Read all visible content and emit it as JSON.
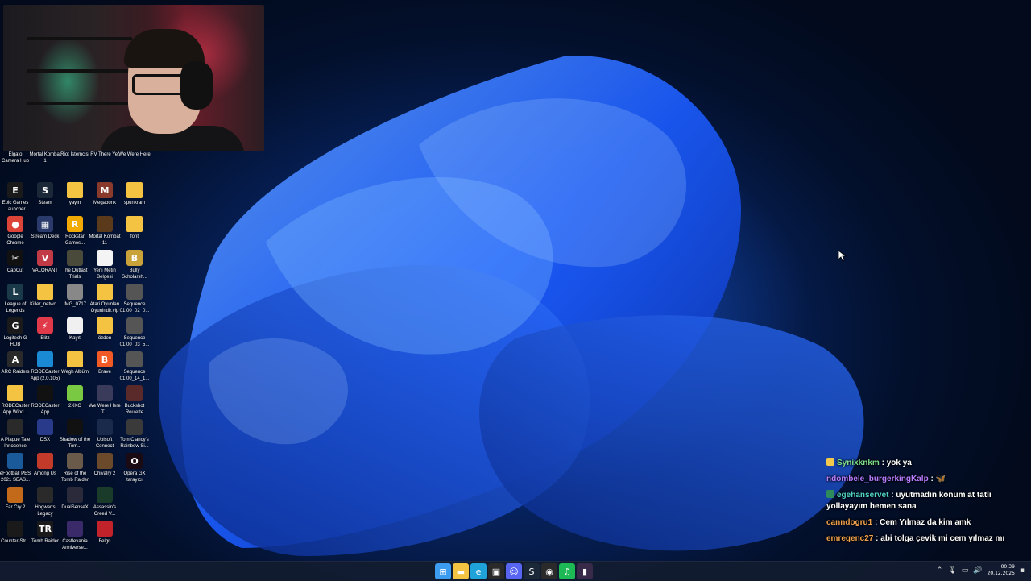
{
  "desktop": {
    "icons": [
      {
        "label": "Elgato Camera Hub",
        "icon": "camera-icon",
        "color": "#2b2b2b",
        "glyph": "",
        "col": 0,
        "row": 0
      },
      {
        "label": "Mortal Kombat 1",
        "icon": "game-icon",
        "color": "#3a2a1a",
        "glyph": "",
        "col": 1,
        "row": 0
      },
      {
        "label": "Riot İstemcisi",
        "icon": "riot-icon",
        "color": "#d13639",
        "glyph": "",
        "col": 2,
        "row": 0
      },
      {
        "label": "RV There Yet",
        "icon": "game-icon",
        "color": "#4a6b2a",
        "glyph": "",
        "col": 3,
        "row": 0
      },
      {
        "label": "We Were Here",
        "icon": "game-icon",
        "color": "#3c3c5a",
        "glyph": "",
        "col": 4,
        "row": 0
      },
      {
        "label": "Epic Games Launcher",
        "icon": "epic-games-icon",
        "color": "#1a1a1a",
        "glyph": "E",
        "col": 0,
        "row": 1
      },
      {
        "label": "Steam",
        "icon": "steam-icon",
        "color": "#1b2838",
        "glyph": "S",
        "col": 1,
        "row": 1
      },
      {
        "label": "yayın",
        "icon": "folder-icon",
        "color": "#f5c342",
        "glyph": "",
        "col": 2,
        "row": 1
      },
      {
        "label": "Megabonk",
        "icon": "game-icon",
        "color": "#8a3a2a",
        "glyph": "M",
        "col": 3,
        "row": 1
      },
      {
        "label": "spunkram",
        "icon": "folder-icon",
        "color": "#f5c342",
        "glyph": "",
        "col": 4,
        "row": 1
      },
      {
        "label": "Google Chrome",
        "icon": "chrome-icon",
        "color": "#db4437",
        "glyph": "●",
        "col": 0,
        "row": 2
      },
      {
        "label": "Stream Deck",
        "icon": "stream-deck-icon",
        "color": "#2a3a6a",
        "glyph": "▦",
        "col": 1,
        "row": 2
      },
      {
        "label": "Rockstar Games...",
        "icon": "rockstar-icon",
        "color": "#f2a900",
        "glyph": "R",
        "col": 2,
        "row": 2
      },
      {
        "label": "Mortal Kombat 11",
        "icon": "game-icon",
        "color": "#5a3a1a",
        "glyph": "",
        "col": 3,
        "row": 2
      },
      {
        "label": "font",
        "icon": "folder-icon",
        "color": "#f5c342",
        "glyph": "",
        "col": 4,
        "row": 2
      },
      {
        "label": "CapCut",
        "icon": "capcut-icon",
        "color": "#111111",
        "glyph": "✂",
        "col": 0,
        "row": 3
      },
      {
        "label": "VALORANT",
        "icon": "valorant-icon",
        "color": "#c23a45",
        "glyph": "V",
        "col": 1,
        "row": 3
      },
      {
        "label": "The Outlast Trials",
        "icon": "game-icon",
        "color": "#4a4a3a",
        "glyph": "",
        "col": 2,
        "row": 3
      },
      {
        "label": "Yeni Metin Belgesi",
        "icon": "text-document-icon",
        "color": "#f4f4f4",
        "glyph": "",
        "col": 3,
        "row": 3
      },
      {
        "label": "Bully Scholarsh...",
        "icon": "game-icon",
        "color": "#c9a23a",
        "glyph": "B",
        "col": 4,
        "row": 3
      },
      {
        "label": "League of Legends",
        "icon": "league-icon",
        "color": "#1a3a4a",
        "glyph": "L",
        "col": 0,
        "row": 4
      },
      {
        "label": "Killer_netwo...",
        "icon": "folder-icon",
        "color": "#f5c342",
        "glyph": "",
        "col": 1,
        "row": 4
      },
      {
        "label": "IMG_0717",
        "icon": "image-file-icon",
        "color": "#888888",
        "glyph": "",
        "col": 2,
        "row": 4
      },
      {
        "label": "Atari Oyunları Oyunindir.vip",
        "icon": "folder-icon",
        "color": "#f5c342",
        "glyph": "",
        "col": 3,
        "row": 4
      },
      {
        "label": "Sequence 01.00_02_0...",
        "icon": "video-file-icon",
        "color": "#555555",
        "glyph": "",
        "col": 4,
        "row": 4
      },
      {
        "label": "Logitech G HUB",
        "icon": "logitech-icon",
        "color": "#1a1a1a",
        "glyph": "G",
        "col": 0,
        "row": 5
      },
      {
        "label": "Blitz",
        "icon": "blitz-icon",
        "color": "#e03a4a",
        "glyph": "⚡",
        "col": 1,
        "row": 5
      },
      {
        "label": "Kayıt",
        "icon": "obs-icon",
        "color": "#f0f0f0",
        "glyph": "",
        "col": 2,
        "row": 5
      },
      {
        "label": "özden",
        "icon": "folder-icon",
        "color": "#f5c342",
        "glyph": "",
        "col": 3,
        "row": 5
      },
      {
        "label": "Sequence 01.00_03_5...",
        "icon": "video-file-icon",
        "color": "#555555",
        "glyph": "",
        "col": 4,
        "row": 5
      },
      {
        "label": "ARC Raiders",
        "icon": "game-icon",
        "color": "#2a2a2a",
        "glyph": "A",
        "col": 0,
        "row": 6
      },
      {
        "label": "RODECaster App (2.0.105)",
        "icon": "rodecaster-icon",
        "color": "#1a8ad4",
        "glyph": "",
        "col": 1,
        "row": 6
      },
      {
        "label": "Wegh Albüm",
        "icon": "folder-icon",
        "color": "#f5c342",
        "glyph": "",
        "col": 2,
        "row": 6
      },
      {
        "label": "Brave",
        "icon": "brave-icon",
        "color": "#f15a24",
        "glyph": "B",
        "col": 3,
        "row": 6
      },
      {
        "label": "Sequence 01.00_14_1...",
        "icon": "video-file-icon",
        "color": "#555555",
        "glyph": "",
        "col": 4,
        "row": 6
      },
      {
        "label": "RODECaster App Wind...",
        "icon": "folder-icon",
        "color": "#f5c342",
        "glyph": "",
        "col": 0,
        "row": 7
      },
      {
        "label": "RODECaster App",
        "icon": "rodecaster-icon",
        "color": "#111111",
        "glyph": "",
        "col": 1,
        "row": 7
      },
      {
        "label": "2XKO",
        "icon": "game-icon",
        "color": "#7ac943",
        "glyph": "",
        "col": 2,
        "row": 7
      },
      {
        "label": "We Were Here T...",
        "icon": "game-icon",
        "color": "#3a3a5a",
        "glyph": "",
        "col": 3,
        "row": 7
      },
      {
        "label": "Buckshot Roulette",
        "icon": "game-icon",
        "color": "#5a2a2a",
        "glyph": "",
        "col": 4,
        "row": 7
      },
      {
        "label": "A Plague Tale Innocence",
        "icon": "game-icon",
        "color": "#2a2a2a",
        "glyph": "",
        "col": 0,
        "row": 8
      },
      {
        "label": "DSX",
        "icon": "gamepad-icon",
        "color": "#2a3a8a",
        "glyph": "",
        "col": 1,
        "row": 8
      },
      {
        "label": "Shadow of the Tom...",
        "icon": "game-icon",
        "color": "#111111",
        "glyph": "",
        "col": 2,
        "row": 8
      },
      {
        "label": "Ubisoft Connect",
        "icon": "ubisoft-icon",
        "color": "#1a2a4a",
        "glyph": "",
        "col": 3,
        "row": 8
      },
      {
        "label": "Tom Clancy's Rainbow Si...",
        "icon": "game-icon",
        "color": "#3a3a3a",
        "glyph": "",
        "col": 4,
        "row": 8
      },
      {
        "label": "eFootball PES 2021 SEAS...",
        "icon": "game-icon",
        "color": "#1a5a9a",
        "glyph": "",
        "col": 0,
        "row": 9
      },
      {
        "label": "Among Us",
        "icon": "game-icon",
        "color": "#c23a2a",
        "glyph": "",
        "col": 1,
        "row": 9
      },
      {
        "label": "Rise of the Tomb Raider",
        "icon": "game-icon",
        "color": "#6a5a4a",
        "glyph": "",
        "col": 2,
        "row": 9
      },
      {
        "label": "Chivalry 2",
        "icon": "game-icon",
        "color": "#6a4a2a",
        "glyph": "",
        "col": 3,
        "row": 9
      },
      {
        "label": "Opera GX tarayıcı",
        "icon": "opera-gx-icon",
        "color": "#1a0a14",
        "glyph": "O",
        "col": 4,
        "row": 9
      },
      {
        "label": "Far Cry 2",
        "icon": "game-icon",
        "color": "#c26a1a",
        "glyph": "",
        "col": 0,
        "row": 10
      },
      {
        "label": "Hogwarts Legacy",
        "icon": "game-icon",
        "color": "#2a2a2a",
        "glyph": "",
        "col": 1,
        "row": 10
      },
      {
        "label": "DualSenseX",
        "icon": "gamepad-icon",
        "color": "#2a2a3a",
        "glyph": "",
        "col": 2,
        "row": 10
      },
      {
        "label": "Assassin's Creed V...",
        "icon": "game-icon",
        "color": "#1a3a2a",
        "glyph": "",
        "col": 3,
        "row": 10
      },
      {
        "label": "Counter-Str...",
        "icon": "game-icon",
        "color": "#1a1a1a",
        "glyph": "",
        "col": 0,
        "row": 11
      },
      {
        "label": "Tomb Raider",
        "icon": "game-icon",
        "color": "#1a1a1a",
        "glyph": "TR",
        "col": 1,
        "row": 11
      },
      {
        "label": "Castlevania Anniverse...",
        "icon": "game-icon",
        "color": "#3a2a6a",
        "glyph": "",
        "col": 2,
        "row": 11
      },
      {
        "label": "Felgn",
        "icon": "game-icon",
        "color": "#c2222a",
        "glyph": "",
        "col": 3,
        "row": 11
      }
    ]
  },
  "chat": {
    "messages": [
      {
        "user": "Synixknkm",
        "user_color": "#7ee08a",
        "badge_color": "#f2c94c",
        "text": "yok ya"
      },
      {
        "user": "ndombele_burgerkingKalp",
        "user_color": "#b87cff",
        "badge_color": "",
        "text": "🦋"
      },
      {
        "user": "egehanservet",
        "user_color": "#4fd1c5",
        "badge_color": "#2d8a5a",
        "text": "uyutmadın konum at tatlı yollayayım hemen sana"
      },
      {
        "user": "canndogru1",
        "user_color": "#f2a34c",
        "badge_color": "",
        "text": "Cem Yılmaz da kim amk"
      },
      {
        "user": "emregenc27",
        "user_color": "#f2a34c",
        "badge_color": "",
        "text": "abi tolga çevik mi cem yılmaz mı"
      }
    ]
  },
  "taskbar": {
    "apps": [
      {
        "name": "start-button",
        "icon": "windows-start-icon",
        "color": "#3b9cf0",
        "glyph": "⊞"
      },
      {
        "name": "file-explorer",
        "icon": "folder-icon",
        "color": "#f5c342",
        "glyph": "▬"
      },
      {
        "name": "edge",
        "icon": "edge-icon",
        "color": "#1fa3d8",
        "glyph": "e"
      },
      {
        "name": "store",
        "icon": "store-icon",
        "color": "#2a2a2a",
        "glyph": "▣"
      },
      {
        "name": "discord",
        "icon": "discord-icon",
        "color": "#5865f2",
        "glyph": "☺"
      },
      {
        "name": "steam",
        "icon": "steam-icon",
        "color": "#1b2838",
        "glyph": "S"
      },
      {
        "name": "obs",
        "icon": "obs-icon",
        "color": "#2a2a2a",
        "glyph": "◉"
      },
      {
        "name": "spotify",
        "icon": "spotify-icon",
        "color": "#1db954",
        "glyph": "♫"
      },
      {
        "name": "app",
        "icon": "app-icon",
        "color": "#3a2a4a",
        "glyph": "▮"
      }
    ],
    "time": "00:39",
    "date": "20.12.2025"
  }
}
